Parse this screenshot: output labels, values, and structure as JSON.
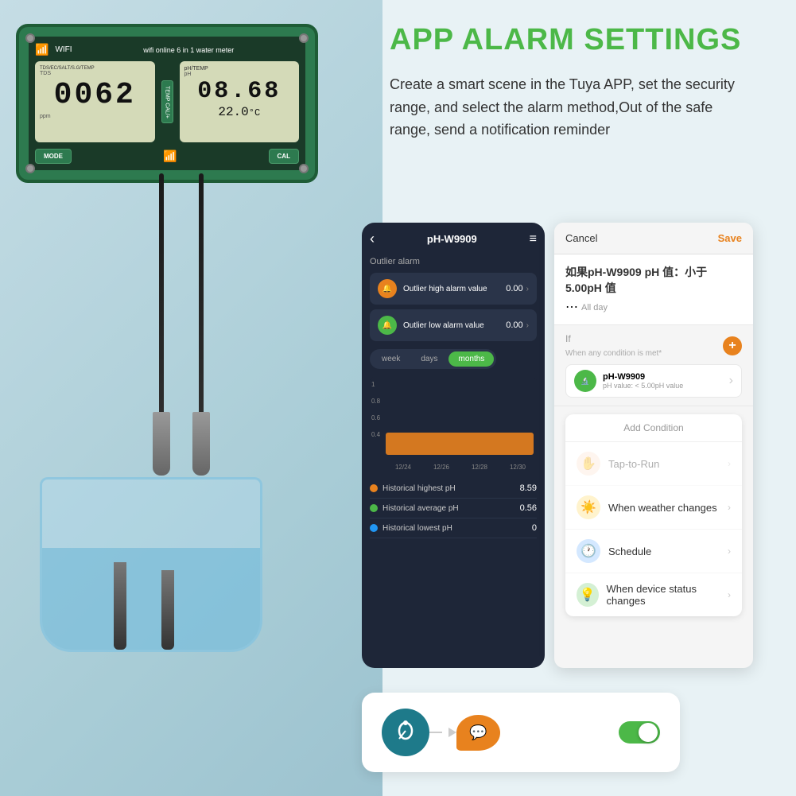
{
  "page": {
    "title": "APP ALARM SETTINGS",
    "background_color": "#b8d8e0"
  },
  "header": {
    "title": "APP ALARM SETTINGS",
    "description": "Create a smart scene in the Tuya APP, set the security range, and select the alarm method,Out of the safe range, send a notification reminder"
  },
  "device": {
    "label": "wifi online 6 in 1 water meter",
    "tds_value": "0062",
    "tds_label": "TDS",
    "ppm_label": "ppm",
    "ph_value": "08.68",
    "temp_value": "22.0",
    "temp_unit": "°C",
    "left_panel_label": "TDS/EC/SALT/S.G/TEMP",
    "right_panel_label": "pH/TEMP",
    "mode_btn": "MODE",
    "cal_btn": "CAL",
    "temp_cal_btn": "TEMP CAL/+"
  },
  "phone_app": {
    "title": "pH-W9909",
    "back_icon": "‹",
    "menu_icon": "≡",
    "section_title": "Outlier alarm",
    "alarm_rows": [
      {
        "label": "Outlier high alarm value",
        "value": "0.00",
        "icon_color": "orange"
      },
      {
        "label": "Outlier low alarm value",
        "value": "0.00",
        "icon_color": "green"
      }
    ],
    "period_options": [
      "week",
      "days",
      "months"
    ],
    "active_period": "months",
    "chart_y_labels": [
      "1",
      "0.8",
      "0.6",
      "0.4"
    ],
    "chart_x_labels": [
      "12/24",
      "12/26",
      "12/28",
      "12/30"
    ],
    "stats": [
      {
        "label": "Historical highest pH",
        "value": "8.59",
        "color": "#e8821e"
      },
      {
        "label": "Historical average pH",
        "value": "0.56",
        "color": "#4cb848"
      },
      {
        "label": "Historical lowest pH",
        "value": "0",
        "color": "#2196f3"
      }
    ]
  },
  "condition_panel": {
    "cancel_label": "Cancel",
    "save_label": "Save",
    "condition_name": "如果pH-W9909 pH 值：小于 5.00pH 值",
    "all_day_label": "All day",
    "if_label": "If",
    "when_condition_label": "When any condition is met*",
    "device_name": "pH-W9909",
    "device_sub": "pH value: < 5.00pH value",
    "add_condition_title": "Add Condition",
    "options": [
      {
        "icon": "✋",
        "label": "Tap-to-Run",
        "style": "hand",
        "disabled": true
      },
      {
        "icon": "☀️",
        "label": "When weather changes",
        "style": "sun",
        "disabled": false
      },
      {
        "icon": "🕐",
        "label": "Schedule",
        "style": "clock",
        "disabled": false
      },
      {
        "icon": "💡",
        "label": "When device status changes",
        "style": "device",
        "disabled": false
      }
    ]
  },
  "bottom_card": {
    "toggle_on": true,
    "arrow_icon": "→"
  }
}
